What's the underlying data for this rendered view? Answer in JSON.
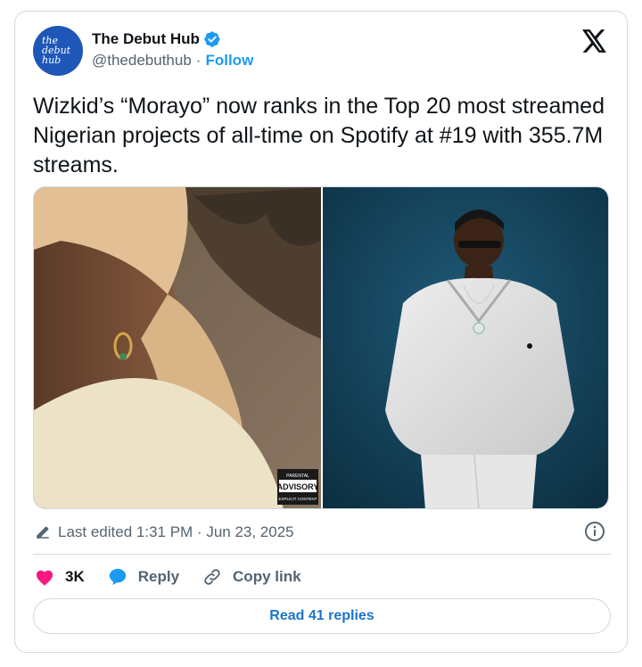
{
  "author": {
    "name": "The Debut Hub",
    "handle": "@thedebuthub",
    "follow_label": "Follow",
    "avatar_text": [
      "the",
      "debut",
      "hub"
    ],
    "verified": true
  },
  "tweet": {
    "text": "Wizkid’s “Morayo” now ranks in the Top 20 most streamed Nigerian projects of all-time on Spotify at #19 with 355.7M streams."
  },
  "media": {
    "images": [
      {
        "description_icon": "photo",
        "advisory_text": [
          "PARENTAL",
          "ADVISORY",
          "EXPLICIT CONTENT"
        ]
      },
      {
        "description_icon": "photo"
      }
    ]
  },
  "meta": {
    "edited": "Last edited 1:31 PM · Jun 23, 2025"
  },
  "actions": {
    "like_count": "3K",
    "reply_label": "Reply",
    "copy_label": "Copy link"
  },
  "footer": {
    "read_replies": "Read 41 replies"
  },
  "colors": {
    "accent": "#1d9bf0",
    "like": "#f91880",
    "avatar_bg": "#1f57b8",
    "text_secondary": "#536471"
  }
}
